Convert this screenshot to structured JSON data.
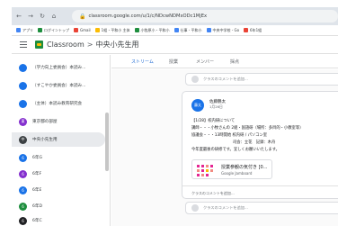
{
  "browser": {
    "url": "classroom.google.com/u/1/c/NDcwNDMxODc1MjEx",
    "nav_icons": [
      "back-icon",
      "forward-icon",
      "reload-icon",
      "home-icon"
    ]
  },
  "bookmarks": [
    {
      "label": "アプリ",
      "color": "#4285f4"
    },
    {
      "label": "ログイントップ",
      "color": "#1e8e3e"
    },
    {
      "label": "Gmail",
      "color": "#ea4335"
    },
    {
      "label": "1組・平和小 主体",
      "color": "#fbbc04"
    },
    {
      "label": "小牧原小・平和小",
      "color": "#1e8e3e"
    },
    {
      "label": "仕事 - 平和小",
      "color": "#4285f4"
    },
    {
      "label": "中央中学校 - Go",
      "color": "#4285f4"
    },
    {
      "label": "6年1組",
      "color": "#ea4335"
    }
  ],
  "header": {
    "app_name": "Classroom",
    "separator": ">",
    "course": "中央小先生用"
  },
  "sidebar": {
    "items": [
      {
        "label": "（学力向上委員会）本読み...",
        "color": "#1a73e8",
        "initial": ""
      },
      {
        "label": "（すこやか委員会）本読み...",
        "color": "#1a73e8",
        "initial": ""
      },
      {
        "label": "（主体）本読み教育研究会",
        "color": "#1a73e8",
        "initial": ""
      },
      {
        "label": "東京都の部屋",
        "color": "#8430ce",
        "initial": "東"
      },
      {
        "label": "中央小先生用",
        "color": "#3c4043",
        "initial": "中"
      },
      {
        "label": "6年G",
        "color": "#1a73e8",
        "initial": "6"
      },
      {
        "label": "6年F",
        "color": "#8430ce",
        "initial": "6"
      },
      {
        "label": "6年E",
        "color": "#1a73e8",
        "initial": "6"
      },
      {
        "label": "6年D",
        "color": "#1e8e3e",
        "initial": "6"
      },
      {
        "label": "6年C",
        "color": "#202124",
        "initial": "6"
      }
    ]
  },
  "tabs": [
    {
      "label": "ストリーム",
      "active": true
    },
    {
      "label": "授業",
      "active": false
    },
    {
      "label": "メンバー",
      "active": false
    },
    {
      "label": "採点",
      "active": false
    }
  ],
  "stream": {
    "comment_placeholder": "クラスのコメントを追加...",
    "post": {
      "avatar": "藤太",
      "author": "佐藤鶴太",
      "date": "1月26日",
      "lines": [
        "【1/28】校内研について",
        "講師・・・小牧さんの 2組・国語研（場所：多目的・小教室等）",
        "協議会・・・13時開始 校内研 / パソコン室",
        "司会：立花　記録：木舟",
        "今年度最後の研修です。宜しくお願いいたします。"
      ],
      "attachment": {
        "title": "授業参観の気付き [0...",
        "type": "Google Jamboard"
      },
      "footer_placeholder": "クラスのコメントを追加..."
    }
  },
  "colors": {
    "accent": "#1967d2",
    "classroom_green": "#1e8e3e"
  }
}
